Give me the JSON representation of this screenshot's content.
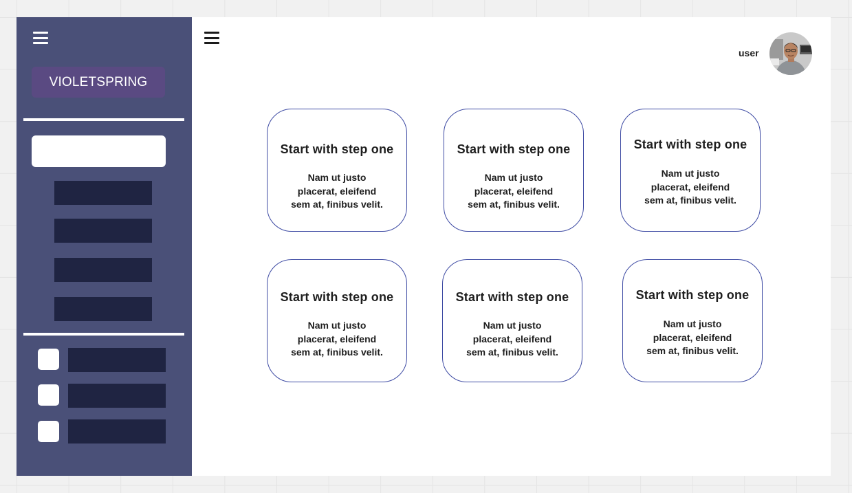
{
  "sidebar": {
    "menu_icon": "hamburger-icon",
    "brand_label": "VIOLETSPRING",
    "search": {
      "value": "",
      "placeholder": ""
    },
    "nav_items": [
      "",
      "",
      "",
      ""
    ],
    "check_items": [
      {
        "checked": false,
        "label": ""
      },
      {
        "checked": false,
        "label": ""
      },
      {
        "checked": false,
        "label": ""
      }
    ]
  },
  "header": {
    "menu_icon": "hamburger-icon",
    "user_label": "user",
    "avatar": "user-avatar"
  },
  "cards": [
    {
      "title": "Start with step one",
      "body": "Nam ut justo\nplacerat, eleifend\nsem at, finibus velit."
    },
    {
      "title": "Start with step one",
      "body": "Nam ut justo\nplacerat, eleifend\nsem at, finibus velit."
    },
    {
      "title": "Start with step one",
      "body": "Nam ut justo\nplacerat, eleifend\nsem at, finibus velit."
    },
    {
      "title": "Start with step one",
      "body": "Nam ut justo\nplacerat, eleifend\nsem at, finibus velit."
    },
    {
      "title": "Start with step one",
      "body": "Nam ut justo\nplacerat, eleifend\nsem at, finibus velit."
    },
    {
      "title": "Start with step one",
      "body": "Nam ut justo\nplacerat, eleifend\nsem at, finibus velit."
    }
  ],
  "colors": {
    "sidebar_bg": "#4a5078",
    "brand_bg": "#5a4a82",
    "nav_item": "#1f2442",
    "card_border": "#3d4aa3",
    "canvas": "#f1f1f1"
  }
}
